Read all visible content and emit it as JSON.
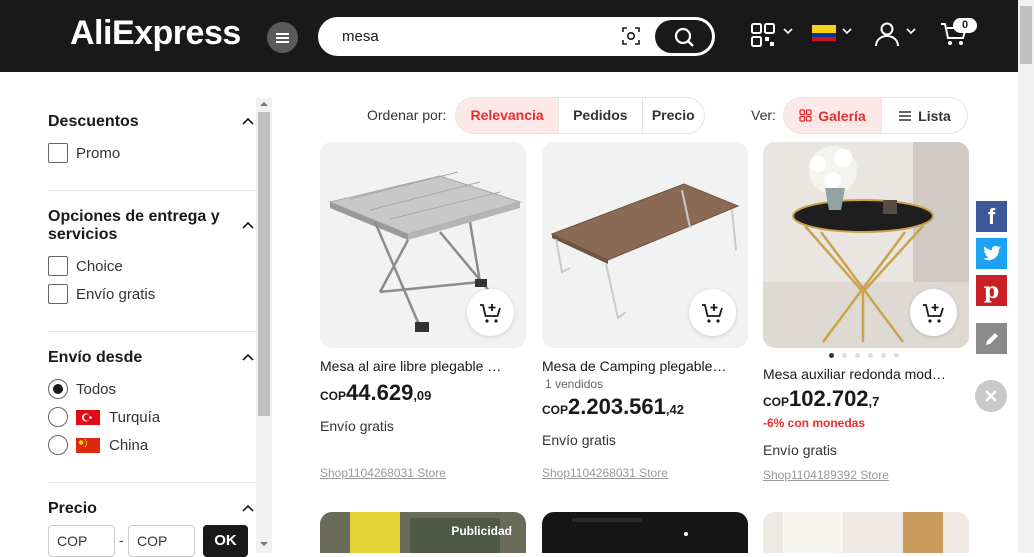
{
  "header": {
    "logo": "AliExpress",
    "search_value": "mesa",
    "cart_count": "0"
  },
  "sidebar": {
    "sections": [
      {
        "title": "Descuentos",
        "options": [
          "Promo"
        ]
      },
      {
        "title": "Opciones de entrega y servicios",
        "options": [
          "Choice",
          "Envío gratis"
        ]
      },
      {
        "title": "Envío desde",
        "options": [
          "Todos",
          "Turquía",
          "China"
        ],
        "selected": "Todos"
      },
      {
        "title": "Precio"
      }
    ],
    "price_min_placeholder": "COP",
    "price_max_placeholder": "COP",
    "price_separator": "-",
    "ok_label": "OK"
  },
  "sort": {
    "label": "Ordenar por:",
    "options": [
      "Relevancia",
      "Pedidos",
      "Precio"
    ],
    "active": "Relevancia"
  },
  "view": {
    "label": "Ver:",
    "options": [
      "Galería",
      "Lista"
    ],
    "active": "Galería"
  },
  "products": [
    {
      "title": "Mesa al aire libre plegable po...",
      "sold": "",
      "currency": "COP",
      "price_int": "44.629",
      "price_dec": ",09",
      "discount": "",
      "shipping": "Envío gratis",
      "store": "Shop1104268031 Store"
    },
    {
      "title": "Mesa de Camping plegable de...",
      "sold": "1 vendidos",
      "currency": "COP",
      "price_int": "2.203.561",
      "price_dec": ",42",
      "discount": "",
      "shipping": "Envío gratis",
      "store": "Shop1104268031 Store"
    },
    {
      "title": "Mesa auxiliar redonda moder...",
      "sold": "",
      "currency": "COP",
      "price_int": "102.702",
      "price_dec": ",7",
      "discount": "-6% con monedas",
      "shipping": "Envío gratis",
      "store": "Shop1104189392 Store"
    }
  ],
  "ad_label": "Publicidad",
  "colors": {
    "accent": "#e62e2e",
    "header_bg": "#191919",
    "facebook": "#3b5998",
    "twitter": "#1da1f2",
    "pinterest": "#cb2027",
    "edit": "#8a8a8a"
  }
}
